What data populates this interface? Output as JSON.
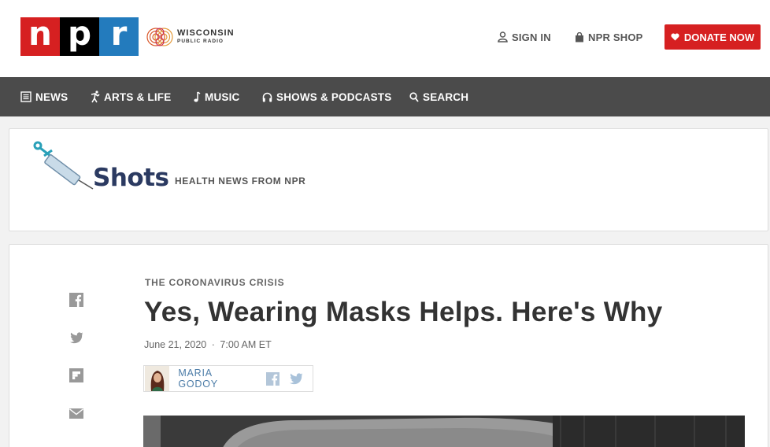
{
  "header": {
    "logo_letters": [
      "n",
      "p",
      "r"
    ],
    "station_line1": "WISCONSIN",
    "station_line2": "PUBLIC RADIO",
    "sign_in": "SIGN IN",
    "shop": "NPR SHOP",
    "donate": "DONATE NOW"
  },
  "nav": {
    "items": [
      {
        "label": "NEWS",
        "icon": "news-icon"
      },
      {
        "label": "ARTS & LIFE",
        "icon": "arts-icon"
      },
      {
        "label": "MUSIC",
        "icon": "music-note-icon"
      },
      {
        "label": "SHOWS & PODCASTS",
        "icon": "headphones-icon"
      },
      {
        "label": "SEARCH",
        "icon": "search-icon"
      }
    ]
  },
  "blog": {
    "title": "Shots",
    "tagline": "HEALTH NEWS FROM NPR"
  },
  "article": {
    "slug": "THE CORONAVIRUS CRISIS",
    "headline": "Yes, Wearing Masks Helps. Here's Why",
    "date": "June 21, 2020",
    "separator": "·",
    "time": "7:00 AM ET",
    "author": "MARIA GODOY"
  },
  "share": [
    "facebook-icon",
    "twitter-icon",
    "flipboard-icon",
    "email-icon"
  ],
  "colors": {
    "npr_red": "#d62021",
    "npr_black": "#000000",
    "npr_blue": "#237bbd",
    "nav_bg": "#4b4b4b",
    "donate_bg": "#d62021",
    "shots_navy": "#2b3a61",
    "author_link": "#4d7da8"
  }
}
